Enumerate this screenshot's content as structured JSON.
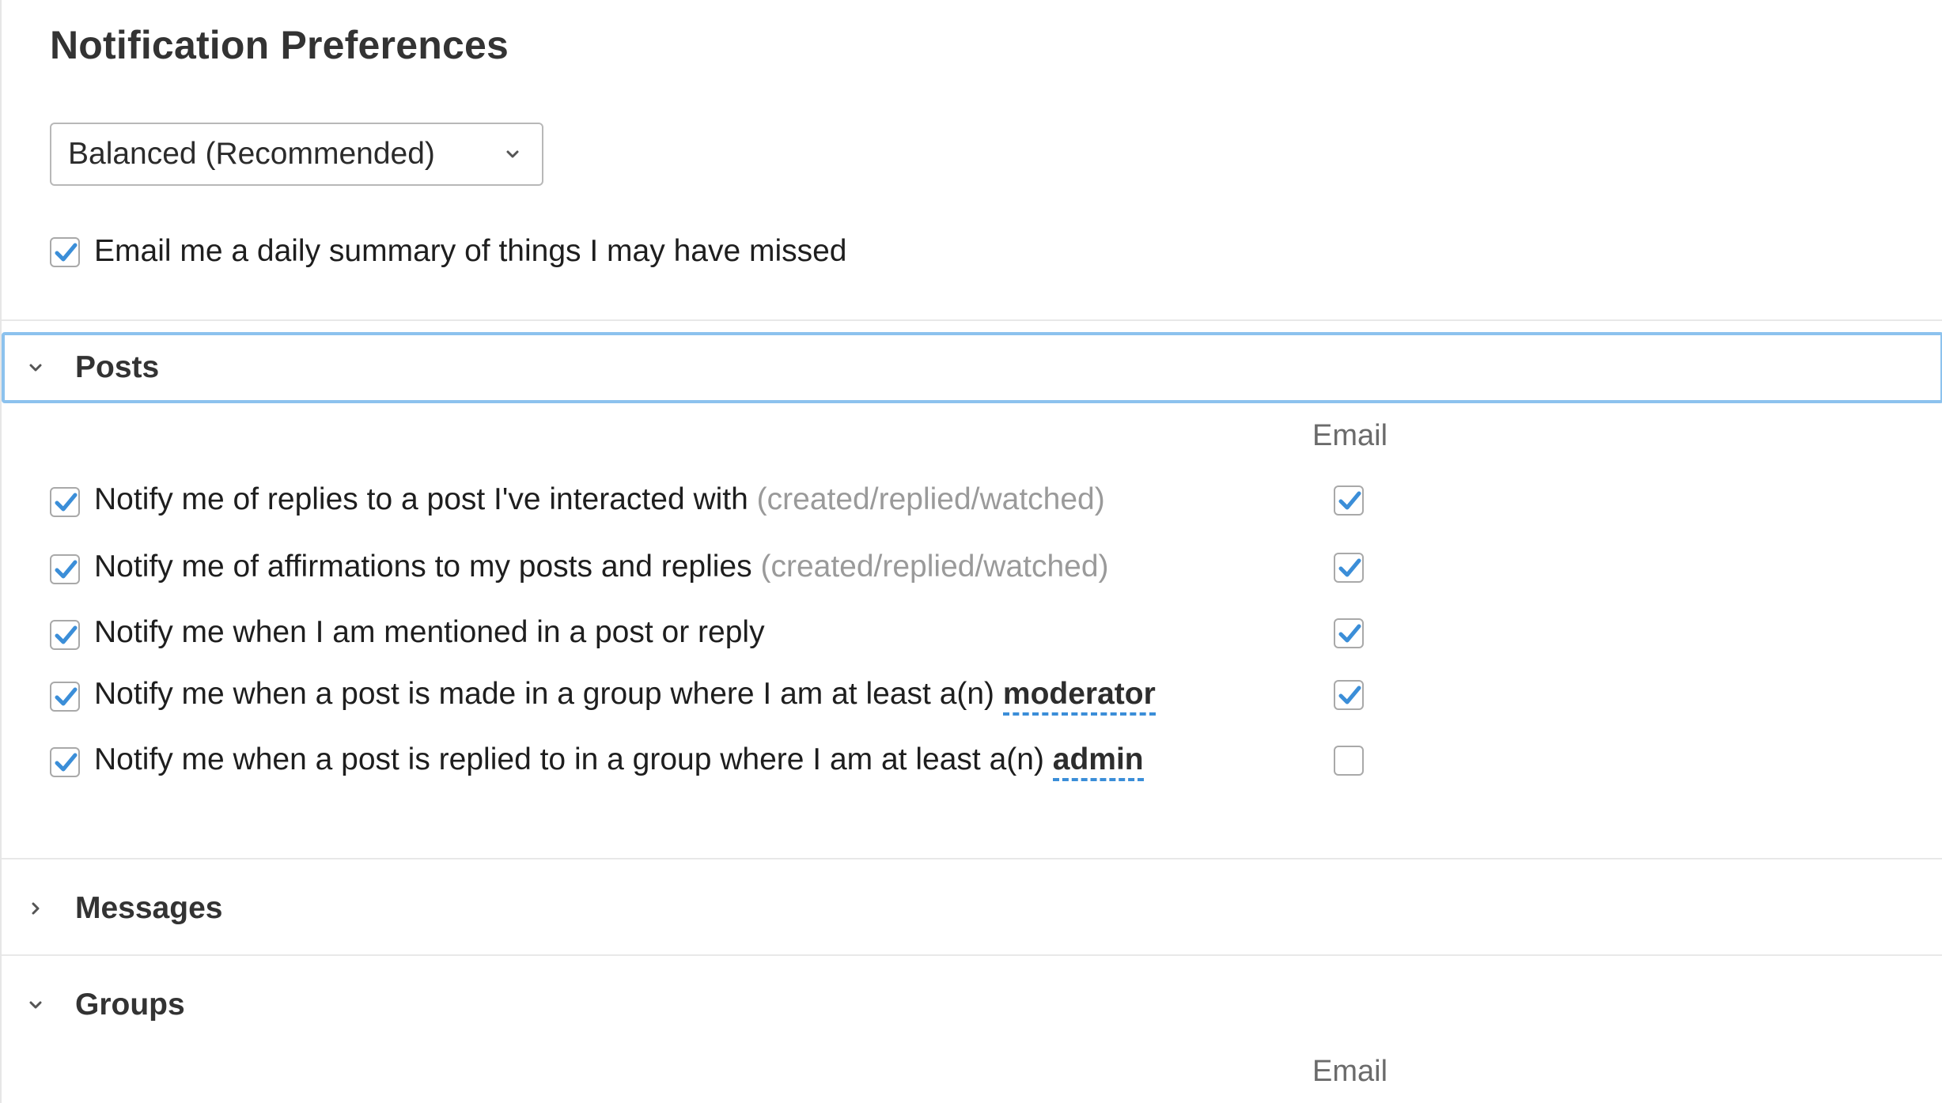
{
  "page": {
    "title": "Notification Preferences"
  },
  "preset": {
    "selected": "Balanced (Recommended)"
  },
  "daily_summary": {
    "label": "Email me a daily summary of things I may have missed",
    "checked": true
  },
  "sections": {
    "posts": {
      "title": "Posts",
      "expanded": true,
      "column_header": "Email",
      "items": [
        {
          "text": "Notify me of replies to a post I've interacted with ",
          "hint": "(created/replied/watched)",
          "role": "",
          "enabled": true,
          "email": true
        },
        {
          "text": "Notify me of affirmations to my posts and replies ",
          "hint": "(created/replied/watched)",
          "role": "",
          "enabled": true,
          "email": true
        },
        {
          "text": "Notify me when I am mentioned in a post or reply",
          "hint": "",
          "role": "",
          "enabled": true,
          "email": true
        },
        {
          "text": "Notify me when a post is made in a group where I am at least a(n) ",
          "hint": "",
          "role": "moderator",
          "enabled": true,
          "email": true
        },
        {
          "text": "Notify me when a post is replied to in a group where I am at least a(n) ",
          "hint": "",
          "role": "admin",
          "enabled": true,
          "email": false
        }
      ]
    },
    "messages": {
      "title": "Messages",
      "expanded": false
    },
    "groups": {
      "title": "Groups",
      "expanded": true,
      "column_header": "Email"
    }
  },
  "colors": {
    "accent": "#3b8ed8",
    "focus_ring": "#8cc2ee",
    "muted_text": "#9a9a9a"
  }
}
